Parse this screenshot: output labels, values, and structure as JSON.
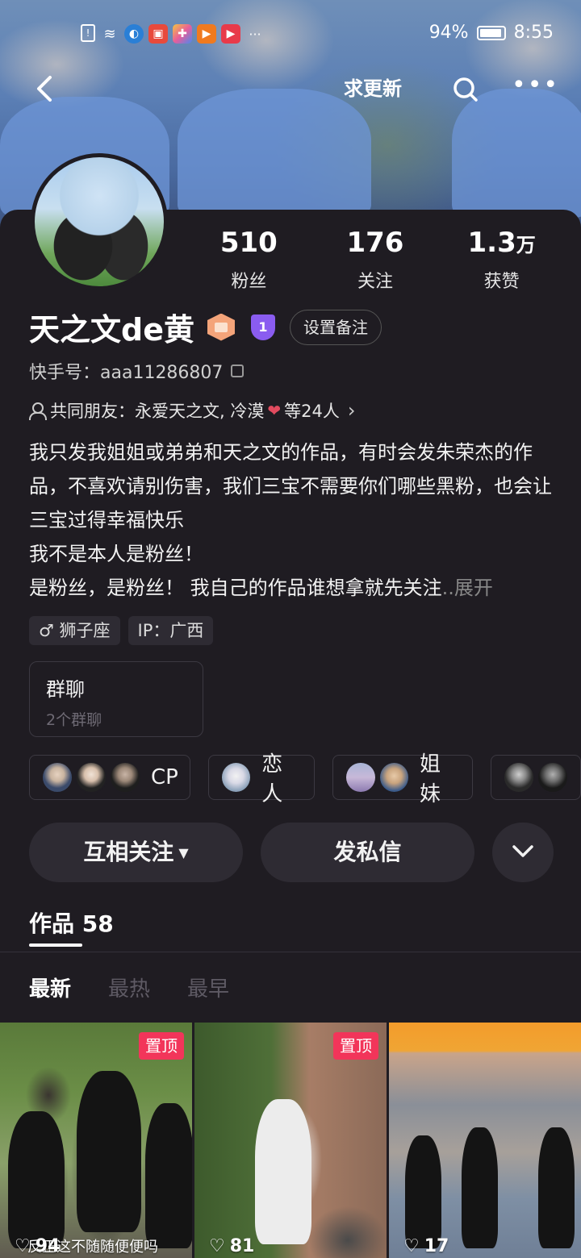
{
  "status_bar": {
    "battery": "94%",
    "time": "8:55",
    "icons": [
      "sim-icon",
      "wifi-icon",
      "app-icon",
      "app-icon",
      "app-icon",
      "app-icon",
      "app-icon",
      "more-dots"
    ]
  },
  "nav": {
    "update_label": "求更新"
  },
  "profile": {
    "name": "天之文de黄",
    "level": "1",
    "remark_label": "设置备注",
    "kuaishou_id_label": "快手号：aaa11286807",
    "friends_prefix": "共同朋友：永爱天之文, 冷漠",
    "friends_suffix": "等24人",
    "bio_lines": [
      "我只发我姐姐或弟弟和天之文的作品，有时会发朱荣杰的作品，不喜欢请别伤害，我们三宝不需要你们哪些黑粉，也会让三宝过得幸福快乐",
      "我不是本人是粉丝！",
      "是粉丝，是粉丝！ 我自己的作品谁想拿就先关注"
    ],
    "expand_label": "..展开",
    "tags": [
      "♂ 狮子座",
      "IP：广西"
    ]
  },
  "stats": [
    {
      "num": "510",
      "unit": "",
      "label": "粉丝"
    },
    {
      "num": "176",
      "unit": "",
      "label": "关注"
    },
    {
      "num": "1.3",
      "unit": "万",
      "label": "获赞"
    }
  ],
  "group": {
    "title": "群聊",
    "subtitle": "2个群聊"
  },
  "relations": [
    {
      "label": "CP"
    },
    {
      "label": "恋人"
    },
    {
      "label": "姐妹"
    }
  ],
  "actions": {
    "follow_label": "互相关注",
    "message_label": "发私信"
  },
  "works": {
    "tab_label": "作品 58",
    "sort": [
      "最新",
      "最热",
      "最早"
    ]
  },
  "videos": [
    {
      "pinned": "置顶",
      "likes": "94",
      "caption": "反正这不随随便便吗"
    },
    {
      "pinned": "置顶",
      "likes": "81",
      "caption": ""
    },
    {
      "pinned": "",
      "likes": "17",
      "caption": ""
    }
  ],
  "colors": {
    "background": "#1f1c22",
    "accent_pin": "#f2355a",
    "level_badge": "#8a5cf0",
    "hex_badge": "#f4a47a"
  }
}
